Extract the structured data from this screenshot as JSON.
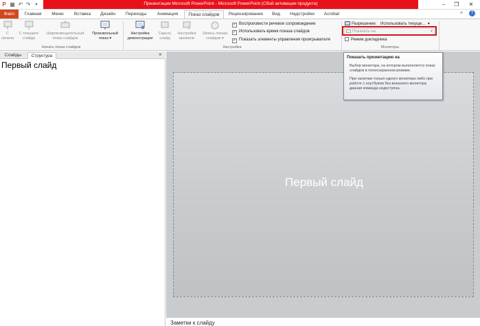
{
  "window": {
    "title": "Презентация Microsoft PowerPoint  -  Microsoft PowerPoint (Сбой активации продукта)",
    "accent_red": "#e8101a",
    "controls": [
      "minimize-icon",
      "restore-icon",
      "close-icon"
    ]
  },
  "quick_access": [
    "powerpoint-logo-icon",
    "save-icon",
    "undo-icon",
    "redo-icon",
    "customize-icon"
  ],
  "tabs": [
    {
      "label": "Файл"
    },
    {
      "label": "Главная"
    },
    {
      "label": "Меню"
    },
    {
      "label": "Вставка"
    },
    {
      "label": "Дизайн"
    },
    {
      "label": "Переходы"
    },
    {
      "label": "Анимация"
    },
    {
      "label": "Показ слайдов",
      "active": true
    },
    {
      "label": "Рецензирование"
    },
    {
      "label": "Вид"
    },
    {
      "label": "Надстройки"
    },
    {
      "label": "Acrobat"
    }
  ],
  "ribbon": {
    "start": {
      "from_start": "С\nначала",
      "from_current": "С текущего\nслайда",
      "broadcast": "Широковещательный\nпоказ слайдов",
      "custom": "Произвольный\nпоказ ▾",
      "group_label": "Начать показ слайдов"
    },
    "setup": {
      "setup_show": "Настройка\nдемонстрации",
      "hide_slide": "Скрыть\nслайд",
      "rehearse": "Настройка\nвремени",
      "record": "Запись показа\nслайдов ▾",
      "chk_narration": "Воспроизвести речевое сопровождение",
      "chk_timings": "Использовать время показа слайдов",
      "chk_controls": "Показать элементы управления проигрывателя",
      "group_label": "Настройка"
    },
    "monitors": {
      "resolution_label": "Разрешение:",
      "resolution_value": "Использовать текуще...",
      "show_on_label": "Показать на:",
      "presenter_view": "Режим докладчика",
      "group_label": "Мониторы"
    }
  },
  "tooltip": {
    "title": "Показать презентацию на",
    "p1": "Выбор монитора, на котором выполняется показ слайдов в полноэкранном режиме.",
    "p2": "При наличии только одного монитора либо при работе с ноутбуком без внешнего монитора данная команда недоступна."
  },
  "left_pane": {
    "tab_slides": "Слайды",
    "tab_outline": "Структура",
    "close": "×",
    "outline_text": "Первый слайд"
  },
  "slide": {
    "title": "Первый слайд"
  },
  "notes": {
    "placeholder": "Заметки к слайду"
  }
}
